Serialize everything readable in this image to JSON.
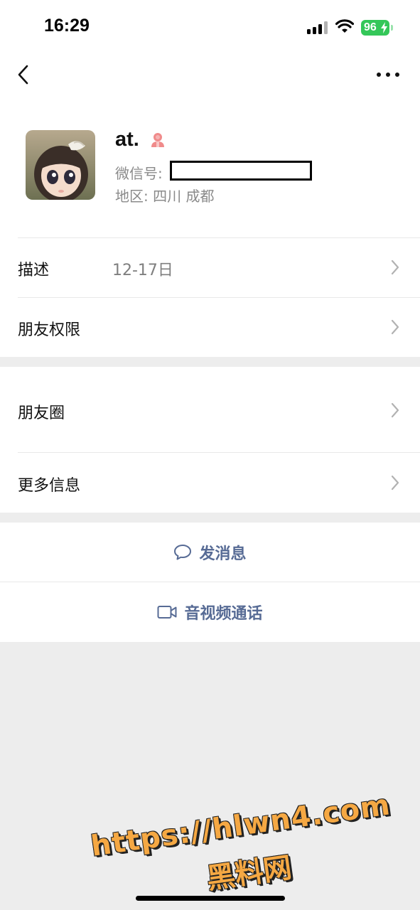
{
  "status_bar": {
    "time": "16:29",
    "battery": "96",
    "battery_color": "#34c759",
    "icons": [
      "cellular-signal-icon",
      "wifi-icon",
      "battery-icon"
    ]
  },
  "nav": {
    "back_icon": "chevron-left-icon",
    "more_icon": "more-dots-icon"
  },
  "profile": {
    "name": "at.",
    "gender_icon": "female-icon",
    "wxid_label": "微信号:",
    "region": "地区: 四川 成都"
  },
  "rows": {
    "description": {
      "label": "描述",
      "value": "12-17日"
    },
    "friend_permission": {
      "label": "朋友权限"
    },
    "moments": {
      "label": "朋友圈"
    },
    "more_info": {
      "label": "更多信息"
    }
  },
  "actions": {
    "message": {
      "label": "发消息",
      "icon": "chat-bubble-icon"
    },
    "av_call": {
      "label": "音视频通话",
      "icon": "video-camera-icon"
    }
  },
  "watermark": {
    "line1": "https://hlwn4.com",
    "line2": "黑料网"
  },
  "colors": {
    "link_blue": "#576b95",
    "gender_pink": "#f08b8b",
    "background_gray": "#ededed"
  }
}
